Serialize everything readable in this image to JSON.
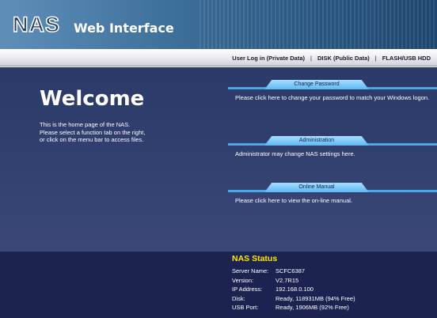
{
  "header": {
    "logo": "NAS",
    "title": "Web Interface"
  },
  "nav": {
    "links": [
      "User Log in (Private Data)",
      "DISK (Public Data)",
      "FLASH/USB HDD"
    ],
    "separator": "|"
  },
  "welcome": {
    "heading": "Welcome",
    "lines": [
      "This is the home page of the NAS.",
      "Please select a function tab on the right,",
      "or click on the menu bar to access files."
    ]
  },
  "panels": [
    {
      "tab": "Change Password",
      "description": "Please click here to change your password to match your Windows logon."
    },
    {
      "tab": "Administration",
      "description": "Administrator may change NAS settings here."
    },
    {
      "tab": "Online Manual",
      "description": "Please click here to view the on-line manual."
    }
  ],
  "status": {
    "title": "NAS Status",
    "rows": [
      {
        "label": "Server Name:",
        "value": "SCFC6387"
      },
      {
        "label": "Version:",
        "value": "V2.7R15"
      },
      {
        "label": "IP Address:",
        "value": "192.168.0.100"
      },
      {
        "label": "Disk:",
        "value": "Ready, 118931MB (94% Free)"
      },
      {
        "label": "USB Port:",
        "value": "Ready, 1906MB (92% Free)"
      }
    ]
  },
  "colors": {
    "header_gradient_start": "#5f8fb9",
    "main_background": "#2c3a6a",
    "tab_accent": "#5cb9f3",
    "status_background": "#1c2350",
    "status_title": "#ffe600"
  }
}
